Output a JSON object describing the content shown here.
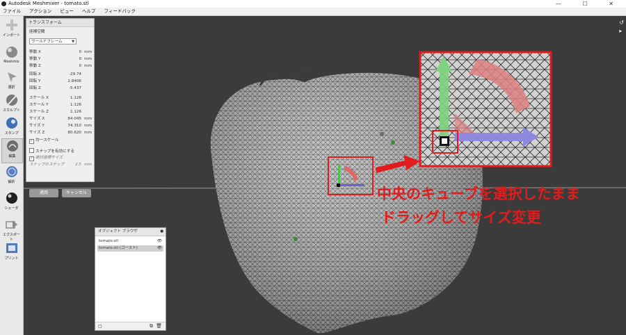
{
  "window": {
    "title": "Autodesk Meshmixer - tomato.stl",
    "controls": "— ☐ ✕"
  },
  "menu": [
    "ファイル",
    "アクション",
    "ビュー",
    "ヘルプ",
    "フィードバック"
  ],
  "tools": [
    {
      "icon": "plus-icon",
      "label": "インポート"
    },
    {
      "icon": "sphere-icon",
      "label": "Meshmix"
    },
    {
      "icon": "arrow-select-icon",
      "label": "選択"
    },
    {
      "icon": "brush-icon",
      "label": "スカルプト"
    },
    {
      "icon": "stamp-icon",
      "label": "スタンプ"
    },
    {
      "icon": "edit-icon",
      "label": "編集"
    },
    {
      "icon": "analysis-icon",
      "label": "解析"
    },
    {
      "icon": "shader-icon",
      "label": "シェーダ"
    },
    {
      "icon": "export-icon",
      "label": "エクスポート"
    },
    {
      "icon": "print-icon",
      "label": "プリント"
    }
  ],
  "transform_panel": {
    "title": "トランスフォーム",
    "coord_label": "座標空間",
    "coord_value": "ワールドフレーム",
    "translate": [
      {
        "label": "移動 X",
        "value": "0",
        "unit": "mm"
      },
      {
        "label": "移動 Y",
        "value": "0",
        "unit": "mm"
      },
      {
        "label": "移動 Z",
        "value": "0",
        "unit": "mm"
      }
    ],
    "rotate": [
      {
        "label": "回転 X",
        "value": "-29.74",
        "unit": ""
      },
      {
        "label": "回転 Y",
        "value": "2.8406",
        "unit": ""
      },
      {
        "label": "回転 Z",
        "value": "-5.437",
        "unit": ""
      }
    ],
    "scale": [
      {
        "label": "スケール X",
        "value": "1.126",
        "unit": ""
      },
      {
        "label": "スケール Y",
        "value": "1.126",
        "unit": ""
      },
      {
        "label": "スケール Z",
        "value": "1.126",
        "unit": ""
      }
    ],
    "size": [
      {
        "label": "サイズ X",
        "value": "84.045",
        "unit": "mm"
      },
      {
        "label": "サイズ Y",
        "value": "74.310",
        "unit": "mm"
      },
      {
        "label": "サイズ Z",
        "value": "80.620",
        "unit": "mm"
      }
    ],
    "uniform_scale": "均一スケール",
    "snap_label": "スナップを有効にする",
    "absolute_size": "絶対座標サイズ",
    "snap_step_label": "スナップのステップ",
    "snap_step_value": "2.5",
    "snap_step_unit": "mm",
    "apply": "適用",
    "cancel": "キャンセル"
  },
  "object_browser": {
    "title": "オブジェクト ブラウザ",
    "items": [
      "tomato.stl",
      "tomato.stl (ゴースト)"
    ]
  },
  "callout": {
    "line1": "中央のキューブを選択したまま",
    "line2": "ドラッグしてサイズ変更"
  },
  "colors": {
    "accent_red": "#e21c1c",
    "apply_button": "#9a9a9a",
    "cancel_button": "#9a9a9a",
    "gizmo_green": "#49c24f",
    "gizmo_blue": "#6a63d6",
    "gizmo_red": "#d86a6a"
  }
}
